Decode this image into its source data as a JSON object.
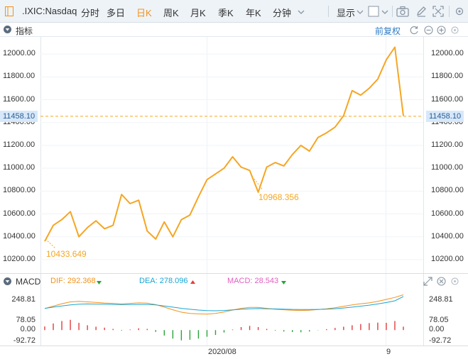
{
  "toolbar": {
    "symbol": ".IXIC:Nasdaq",
    "periods": [
      "分时",
      "多日",
      "日K",
      "周K",
      "月K",
      "季K",
      "年K",
      "分钟"
    ],
    "active_period": "日K",
    "display_label": "显示",
    "icons": [
      "sidebar-toggle-icon",
      "chevron-down-icon",
      "square-select-icon",
      "camera-icon",
      "pencil-icon",
      "fullscreen-icon"
    ]
  },
  "indicator": {
    "title": "指标",
    "adjust_label": "前复权"
  },
  "price_axis": {
    "ticks": [
      "12000.00",
      "11800.00",
      "11600.00",
      "11400.00",
      "11200.00",
      "11000.00",
      "10800.00",
      "10600.00",
      "10400.00",
      "10200.00"
    ],
    "current_price": "11458.10"
  },
  "annotations": {
    "low_label": "10433.649",
    "mid_label": "10968.356"
  },
  "macd": {
    "title": "MACD",
    "dif_label": "DIF: 292.368",
    "dea_label": "DEA: 278.096",
    "macd_label": "MACD: 28.543",
    "ticks": [
      "248.81",
      "78.05",
      "0.00",
      "-92.72"
    ]
  },
  "time_axis": [
    "2020/08",
    "9"
  ],
  "colors": {
    "price_line": "#f5a623",
    "dif": "#f0931d",
    "dea": "#1aa5d4",
    "macd": "#e060c0",
    "bar_up": "#e23c3c",
    "bar_down": "#2aa33a",
    "active": "#f0931d"
  },
  "chart_data": {
    "type": "line",
    "series": [
      {
        "values": [
          10360,
          10500,
          10550,
          10620,
          10400,
          10480,
          10540,
          10470,
          10500,
          10770,
          10690,
          10720,
          10450,
          10380,
          10530,
          10400,
          10550,
          10590,
          10750,
          10900,
          10950,
          11000,
          11100,
          11010,
          10980,
          10790,
          11010,
          11050,
          11020,
          11120,
          11200,
          11150,
          11270,
          11310,
          11360,
          11460,
          11680,
          11640,
          11700,
          11780,
          11950,
          12060,
          11458.1
        ]
      }
    ],
    "ylim": [
      10100,
      12150
    ],
    "x_ticks": [
      "2020/08",
      "9"
    ]
  },
  "macd_data": {
    "dif": [
      178,
      198,
      218,
      233,
      238,
      233,
      229,
      224,
      221,
      217,
      221,
      225,
      223,
      211,
      190,
      168,
      148,
      138,
      134,
      132,
      138,
      150,
      166,
      180,
      188,
      188,
      180,
      172,
      168,
      164,
      162,
      164,
      170,
      176,
      185,
      196,
      208,
      218,
      225,
      238,
      254,
      270,
      292
    ],
    "dea": [
      180,
      190,
      200,
      208,
      214,
      216,
      215,
      214,
      212,
      210,
      211,
      212,
      212,
      208,
      200,
      190,
      180,
      172,
      166,
      161,
      160,
      162,
      167,
      172,
      176,
      178,
      176,
      175,
      173,
      171,
      170,
      170,
      171,
      173,
      177,
      183,
      190,
      198,
      206,
      216,
      228,
      242,
      278
    ],
    "hist": [
      30,
      55,
      75,
      85,
      60,
      40,
      28,
      20,
      10,
      -5,
      5,
      15,
      10,
      -15,
      -45,
      -70,
      -85,
      -80,
      -70,
      -55,
      -40,
      -20,
      5,
      25,
      35,
      25,
      10,
      -5,
      -12,
      -16,
      -18,
      -12,
      -2,
      8,
      18,
      28,
      40,
      50,
      58,
      62,
      60,
      75,
      28.5
    ]
  }
}
